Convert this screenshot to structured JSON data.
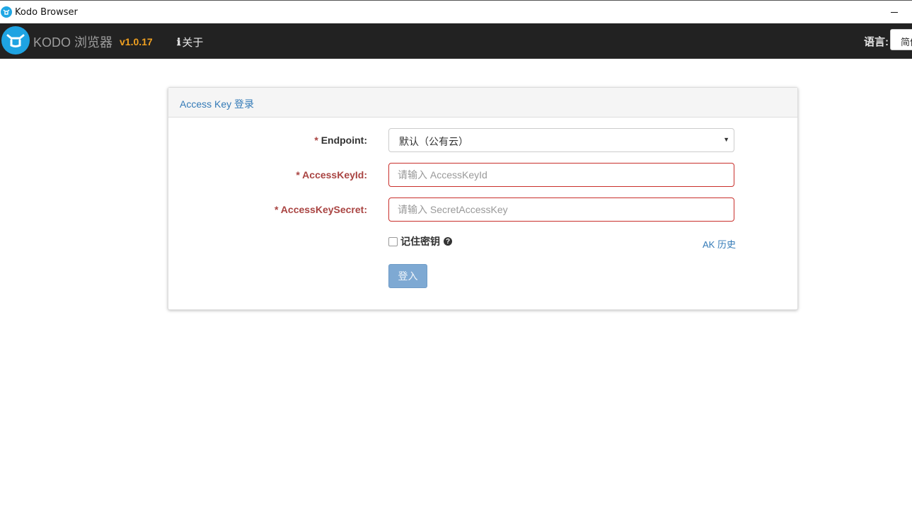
{
  "window": {
    "title": "Kodo Browser",
    "minimize_symbol": "–",
    "icon": "kodo-app-icon"
  },
  "navbar": {
    "brand": "KODO 浏览器",
    "version": "v1.0.17",
    "about_icon": "ℹ",
    "about_label": "关于",
    "language_label": "语言:",
    "language_selected": "简体中文"
  },
  "login": {
    "heading": "Access Key 登录",
    "required_mark": "*",
    "endpoint": {
      "label": "Endpoint:",
      "selected": "默认（公有云）",
      "caret": "▼"
    },
    "access_key_id": {
      "label": "AccessKeyId:",
      "placeholder": "请输入 AccessKeyId",
      "value": ""
    },
    "access_key_secret": {
      "label": "AccessKeySecret:",
      "placeholder": "请输入 SecretAccessKey",
      "value": ""
    },
    "remember": {
      "label": "记住密钥",
      "checked": false,
      "help_icon": "?"
    },
    "ak_history_label": "AK 历史",
    "submit_label": "登入"
  },
  "colors": {
    "navbar_bg": "#222222",
    "brand_blue": "#1ea3e2",
    "version_orange": "#f0a020",
    "error_red": "#a94442",
    "link_blue": "#337ab7",
    "button_blue": "#7ea9d3"
  }
}
